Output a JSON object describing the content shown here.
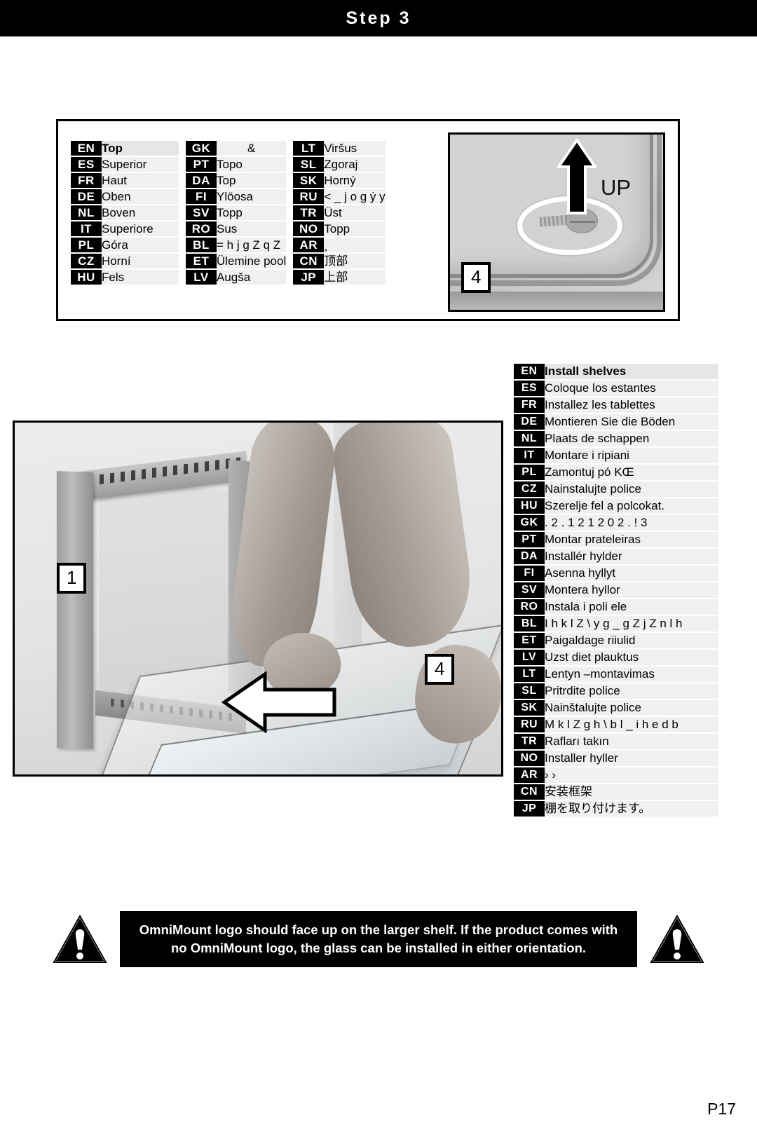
{
  "header": {
    "title": "Step 3"
  },
  "top_panel": {
    "table_col1": [
      {
        "code": "EN",
        "text": "Top",
        "highlight": true
      },
      {
        "code": "ES",
        "text": "Superior"
      },
      {
        "code": "FR",
        "text": "Haut"
      },
      {
        "code": "DE",
        "text": "Oben"
      },
      {
        "code": "NL",
        "text": "Boven"
      },
      {
        "code": "IT",
        "text": "Superiore"
      },
      {
        "code": "PL",
        "text": "Góra"
      },
      {
        "code": "CZ",
        "text": "Horní"
      },
      {
        "code": "HU",
        "text": "Fels"
      }
    ],
    "table_col2": [
      {
        "code": "GK",
        "text": "&",
        "center": true
      },
      {
        "code": "PT",
        "text": "Topo"
      },
      {
        "code": "DA",
        "text": "Top"
      },
      {
        "code": "FI",
        "text": "Ylöosa"
      },
      {
        "code": "SV",
        "text": "Topp"
      },
      {
        "code": "RO",
        "text": "Sus"
      },
      {
        "code": "BL",
        "text": "= h j g Z  q Z"
      },
      {
        "code": "ET",
        "text": "Ülemine pool"
      },
      {
        "code": "LV",
        "text": "Augša"
      }
    ],
    "table_col3": [
      {
        "code": "LT",
        "text": "Viršus"
      },
      {
        "code": "SL",
        "text": "Zgoraj"
      },
      {
        "code": "SK",
        "text": "Horný"
      },
      {
        "code": "RU",
        "text": "< _ j o g ẏ y"
      },
      {
        "code": "TR",
        "text": "Üst"
      },
      {
        "code": "NO",
        "text": "Topp"
      },
      {
        "code": "AR",
        "text": "¸"
      },
      {
        "code": "CN",
        "text": "顶部"
      },
      {
        "code": "JP",
        "text": "上部"
      }
    ],
    "detail_photo": {
      "up_label": "UP",
      "callout": "4",
      "arrow_icon": "up-arrow-icon",
      "highlight_icon": "oval-highlight-icon",
      "part_icon": "screw-icon"
    }
  },
  "main_photo": {
    "callout_left": "1",
    "callout_right": "4",
    "arrow_icon": "left-arrow-icon",
    "alt": "assembly-photo-install-glass-shelf"
  },
  "instruction_table": [
    {
      "code": "EN",
      "text": "Install shelves",
      "highlight": true
    },
    {
      "code": "ES",
      "text": "Coloque los estantes"
    },
    {
      "code": "FR",
      "text": "Installez les tablettes"
    },
    {
      "code": "DE",
      "text": "Montieren Sie die Böden"
    },
    {
      "code": "NL",
      "text": "Plaats de schappen"
    },
    {
      "code": "IT",
      "text": "Montare i ripiani"
    },
    {
      "code": "PL",
      "text": "Zamontuj pó KŒ"
    },
    {
      "code": "CZ",
      "text": "Nainstalujte police"
    },
    {
      "code": "HU",
      "text": "Szerelje fel a polcokat."
    },
    {
      "code": "GK",
      "text": ". 2 . 1 2   1 2 0 2 . ! 3"
    },
    {
      "code": "PT",
      "text": "Montar prateleiras"
    },
    {
      "code": "DA",
      "text": "Installér hylder"
    },
    {
      "code": "FI",
      "text": "Asenna hyllyt"
    },
    {
      "code": "SV",
      "text": "Montera hyllor"
    },
    {
      "code": "RO",
      "text": "Instala i poli ele"
    },
    {
      "code": "BL",
      "text": "I h k l Z \\ y g _  g Z  j Z n l h"
    },
    {
      "code": "ET",
      "text": "Paigaldage riiulid"
    },
    {
      "code": "LV",
      "text": "Uzst  diet plauktus"
    },
    {
      "code": "LT",
      "text": "Lentyn –montavimas"
    },
    {
      "code": "SL",
      "text": "Pritrdite police"
    },
    {
      "code": "SK",
      "text": "Nainštalujte police"
    },
    {
      "code": "RU",
      "text": "M k l Z g h \\ b l _  i h e d b"
    },
    {
      "code": "TR",
      "text": "Rafları takın"
    },
    {
      "code": "NO",
      "text": "Installer hyller"
    },
    {
      "code": "AR",
      "text": "›          ›"
    },
    {
      "code": "CN",
      "text": "安装框架"
    },
    {
      "code": "JP",
      "text": "棚を取り付けます。"
    }
  ],
  "warning": {
    "icon_left": "warning-triangle-icon",
    "icon_right": "warning-triangle-icon",
    "text": "OmniMount logo should face up on the larger shelf.  If the product comes with no OmniMount logo, the glass can be installed in either orientation."
  },
  "footer": {
    "page": "P17"
  },
  "colors": {
    "accent": "#000000",
    "panel": "#f0f0f0",
    "highlight": "#e6e6e6"
  }
}
